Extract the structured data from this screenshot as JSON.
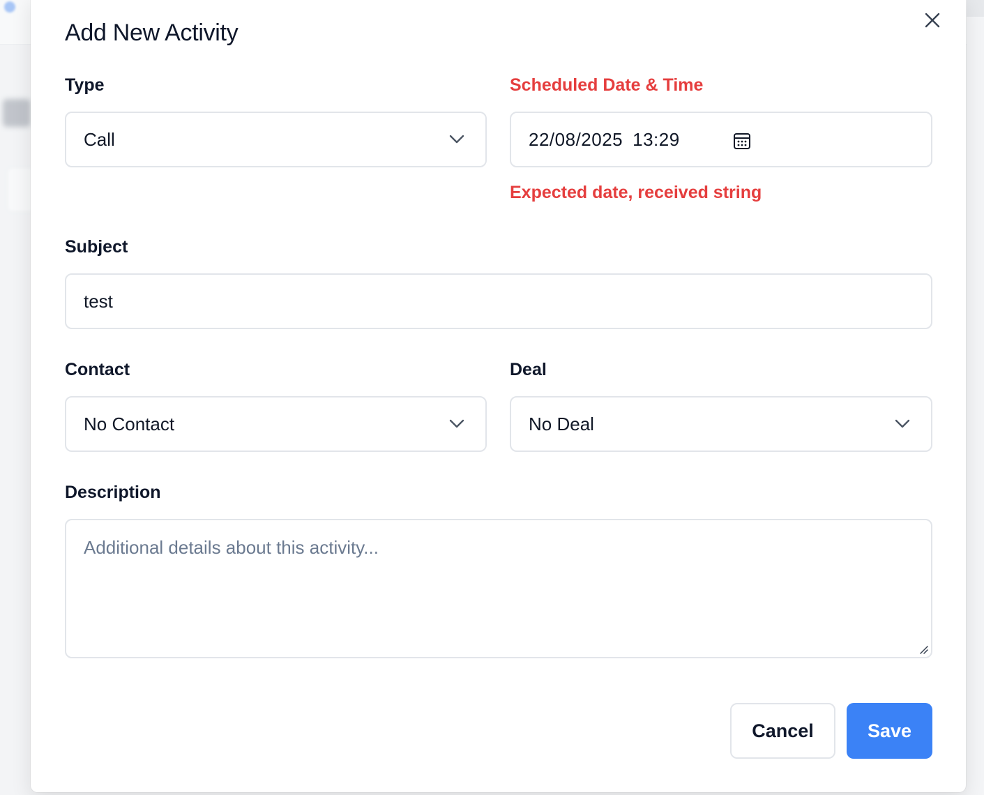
{
  "dialog": {
    "title": "Add New Activity"
  },
  "form": {
    "type": {
      "label": "Type",
      "value": "Call"
    },
    "scheduled": {
      "label": "Scheduled Date & Time",
      "date": "22/08/2025",
      "time": "13:29",
      "error": "Expected date, received string"
    },
    "subject": {
      "label": "Subject",
      "value": "test"
    },
    "contact": {
      "label": "Contact",
      "value": "No Contact"
    },
    "deal": {
      "label": "Deal",
      "value": "No Deal"
    },
    "description": {
      "label": "Description",
      "placeholder": "Additional details about this activity..."
    }
  },
  "actions": {
    "cancel": "Cancel",
    "save": "Save"
  },
  "colors": {
    "primary": "#3b82f6",
    "error": "#e53e3e",
    "text": "#0f172a",
    "border": "#e2e5ea",
    "placeholder": "#6b7a90"
  },
  "icons": {
    "close": "close-icon",
    "chevron": "chevron-down-icon",
    "calendar": "calendar-icon",
    "resize": "resize-grip-icon"
  }
}
